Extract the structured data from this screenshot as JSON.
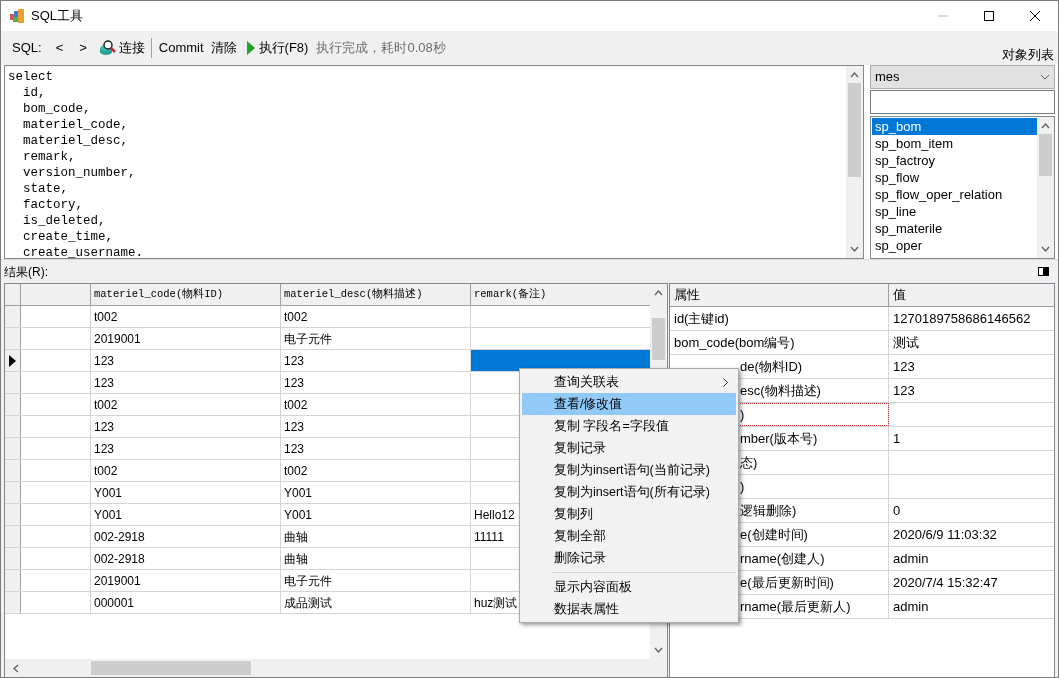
{
  "window": {
    "title": "SQL工具"
  },
  "toolbar": {
    "sql_label": "SQL:",
    "prev": "<",
    "next": ">",
    "connect": "连接",
    "commit": "Commit",
    "clear": "清除",
    "execute": "执行(F8)",
    "status": "执行完成，耗时0.08秒",
    "object_list_label": "对象列表"
  },
  "editor": {
    "lines": [
      "select",
      "  id,",
      "  bom_code,",
      "  materiel_code,",
      "  materiel_desc,",
      "  remark,",
      "  version_number,",
      "  state,",
      "  factory,",
      "  is_deleted,",
      "  create_time,",
      "  create_username."
    ]
  },
  "object_panel": {
    "database": "mes",
    "items": [
      {
        "label": "sp_bom",
        "selected": true
      },
      {
        "label": "sp_bom_item",
        "selected": false
      },
      {
        "label": "sp_factroy",
        "selected": false
      },
      {
        "label": "sp_flow",
        "selected": false
      },
      {
        "label": "sp_flow_oper_relation",
        "selected": false
      },
      {
        "label": "sp_line",
        "selected": false
      },
      {
        "label": "sp_materile",
        "selected": false
      },
      {
        "label": "sp_oper",
        "selected": false
      }
    ]
  },
  "results": {
    "label": "结果(R):",
    "columns": [
      "materiel_code(物料ID)",
      "materiel_desc(物料描述)",
      "remark(备注)"
    ],
    "rows": [
      {
        "materiel_code": "t002",
        "materiel_desc": "t002",
        "current": false
      },
      {
        "materiel_code": "2019001",
        "materiel_desc": "电子元件",
        "current": false
      },
      {
        "materiel_code": "123",
        "materiel_desc": "123",
        "current": true
      },
      {
        "materiel_code": "123",
        "materiel_desc": "123",
        "current": false
      },
      {
        "materiel_code": "t002",
        "materiel_desc": "t002",
        "current": false
      },
      {
        "materiel_code": "123",
        "materiel_desc": "123",
        "current": false
      },
      {
        "materiel_code": "123",
        "materiel_desc": "123",
        "current": false
      },
      {
        "materiel_code": "t002",
        "materiel_desc": "t002",
        "current": false
      },
      {
        "materiel_code": "Y001",
        "materiel_desc": "Y001",
        "current": false
      },
      {
        "materiel_code": "Y001",
        "materiel_desc": "Y001",
        "remark": "Hello12",
        "current": false
      },
      {
        "materiel_code": "002-2918",
        "materiel_desc": "曲轴",
        "remark": "11111",
        "current": false
      },
      {
        "materiel_code": "002-2918",
        "materiel_desc": "曲轴",
        "current": false
      },
      {
        "materiel_code": "2019001",
        "materiel_desc": "电子元件",
        "current": false
      },
      {
        "materiel_code": "000001",
        "materiel_desc": "成品测试",
        "remark": "huz测试",
        "current": false
      }
    ]
  },
  "properties": {
    "columns": [
      "属性",
      "值"
    ],
    "rows": [
      {
        "name": "id(主键id)",
        "value": "1270189758686146562",
        "covered": false,
        "focused": false
      },
      {
        "name": "bom_code(bom编号)",
        "value": "测试",
        "covered": false,
        "focused": false
      },
      {
        "name": "de(物料ID)",
        "value": "123",
        "covered": true,
        "focused": false
      },
      {
        "name": "esc(物料描述)",
        "value": "123",
        "covered": true,
        "focused": false
      },
      {
        "name": ")",
        "covered": true,
        "focused": true
      },
      {
        "name": "mber(版本号)",
        "value": "1",
        "covered": true,
        "focused": false
      },
      {
        "name": "态)",
        "covered": true,
        "focused": false
      },
      {
        "name": ")",
        "covered": true,
        "focused": false
      },
      {
        "name": "逻辑删除)",
        "value": "0",
        "covered": true,
        "focused": false
      },
      {
        "name": "e(创建时间)",
        "value": "2020/6/9 11:03:32",
        "covered": true,
        "focused": false
      },
      {
        "name": "rname(创建人)",
        "value": "admin",
        "covered": true,
        "focused": false
      },
      {
        "name": "e(最后更新时间)",
        "value": "2020/7/4 15:32:47",
        "covered": true,
        "focused": false
      },
      {
        "name": "rname(最后更新人)",
        "value": "admin",
        "covered": true,
        "focused": false
      }
    ]
  },
  "context_menu": {
    "items": [
      {
        "kind": "submenu",
        "label": "查询关联表",
        "selected": false
      },
      {
        "kind": "command",
        "label": "查看/修改值",
        "selected": true
      },
      {
        "kind": "command",
        "label": "复制 字段名=字段值",
        "selected": false
      },
      {
        "kind": "command",
        "label": "复制记录",
        "selected": false
      },
      {
        "kind": "command",
        "label": "复制为insert语句(当前记录)",
        "selected": false
      },
      {
        "kind": "command",
        "label": "复制为insert语句(所有记录)",
        "selected": false
      },
      {
        "kind": "command",
        "label": "复制列",
        "selected": false
      },
      {
        "kind": "command",
        "label": "复制全部",
        "selected": false
      },
      {
        "kind": "command",
        "label": "删除记录",
        "selected": false
      },
      {
        "kind": "separator"
      },
      {
        "kind": "command",
        "label": "显示内容面板",
        "selected": false
      },
      {
        "kind": "command",
        "label": "数据表属性",
        "selected": false
      }
    ]
  }
}
